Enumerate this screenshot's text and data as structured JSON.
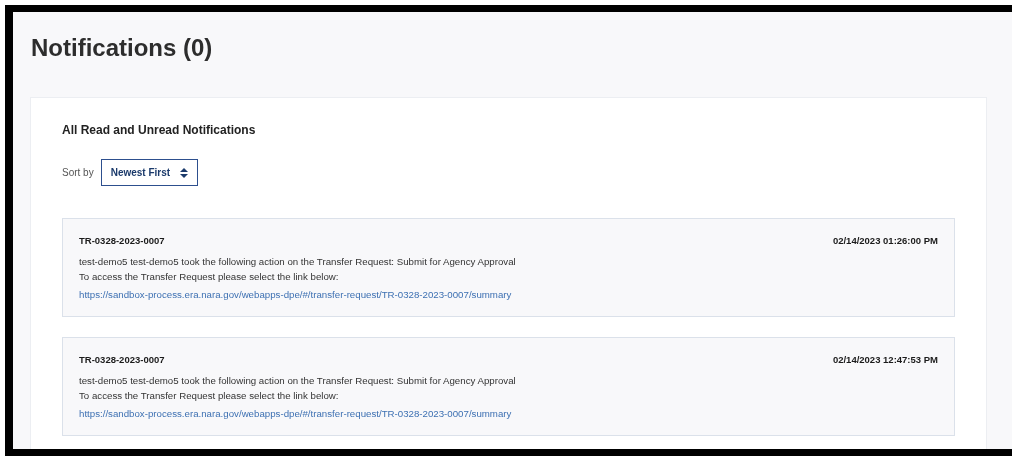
{
  "page": {
    "title": "Notifications (0)"
  },
  "card": {
    "heading": "All Read and Unread Notifications",
    "sort": {
      "label": "Sort by",
      "value": "Newest First"
    },
    "notifications": [
      {
        "id": "TR-0328-2023-0007",
        "timestamp": "02/14/2023 01:26:00 PM",
        "message": "test-demo5 test-demo5 took the following action on the Transfer Request: Submit for Agency Approval",
        "instruction": "To access the Transfer Request please select the link below:",
        "link": "https://sandbox-process.era.nara.gov/webapps-dpe/#/transfer-request/TR-0328-2023-0007/summary"
      },
      {
        "id": "TR-0328-2023-0007",
        "timestamp": "02/14/2023 12:47:53 PM",
        "message": "test-demo5 test-demo5 took the following action on the Transfer Request: Submit for Agency Approval",
        "instruction": "To access the Transfer Request please select the link below:",
        "link": "https://sandbox-process.era.nara.gov/webapps-dpe/#/transfer-request/TR-0328-2023-0007/summary"
      }
    ]
  }
}
